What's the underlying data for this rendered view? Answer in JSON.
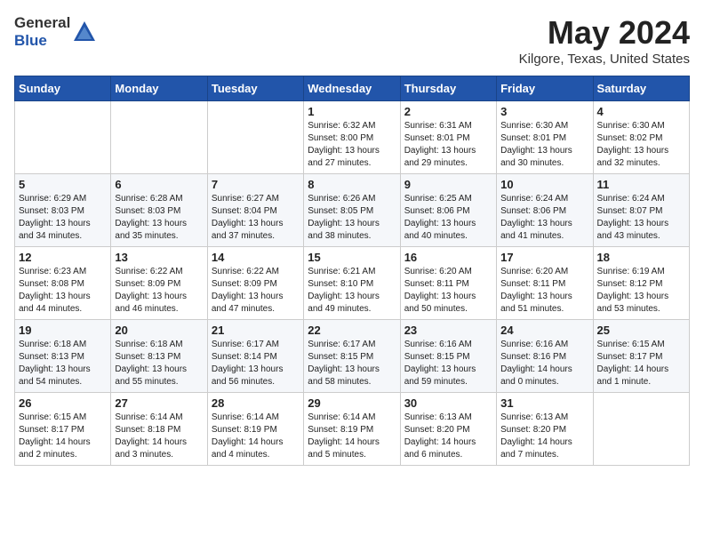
{
  "header": {
    "logo_line1": "General",
    "logo_line2": "Blue",
    "month": "May 2024",
    "location": "Kilgore, Texas, United States"
  },
  "weekdays": [
    "Sunday",
    "Monday",
    "Tuesday",
    "Wednesday",
    "Thursday",
    "Friday",
    "Saturday"
  ],
  "weeks": [
    [
      {
        "day": "",
        "content": ""
      },
      {
        "day": "",
        "content": ""
      },
      {
        "day": "",
        "content": ""
      },
      {
        "day": "1",
        "content": "Sunrise: 6:32 AM\nSunset: 8:00 PM\nDaylight: 13 hours\nand 27 minutes."
      },
      {
        "day": "2",
        "content": "Sunrise: 6:31 AM\nSunset: 8:01 PM\nDaylight: 13 hours\nand 29 minutes."
      },
      {
        "day": "3",
        "content": "Sunrise: 6:30 AM\nSunset: 8:01 PM\nDaylight: 13 hours\nand 30 minutes."
      },
      {
        "day": "4",
        "content": "Sunrise: 6:30 AM\nSunset: 8:02 PM\nDaylight: 13 hours\nand 32 minutes."
      }
    ],
    [
      {
        "day": "5",
        "content": "Sunrise: 6:29 AM\nSunset: 8:03 PM\nDaylight: 13 hours\nand 34 minutes."
      },
      {
        "day": "6",
        "content": "Sunrise: 6:28 AM\nSunset: 8:03 PM\nDaylight: 13 hours\nand 35 minutes."
      },
      {
        "day": "7",
        "content": "Sunrise: 6:27 AM\nSunset: 8:04 PM\nDaylight: 13 hours\nand 37 minutes."
      },
      {
        "day": "8",
        "content": "Sunrise: 6:26 AM\nSunset: 8:05 PM\nDaylight: 13 hours\nand 38 minutes."
      },
      {
        "day": "9",
        "content": "Sunrise: 6:25 AM\nSunset: 8:06 PM\nDaylight: 13 hours\nand 40 minutes."
      },
      {
        "day": "10",
        "content": "Sunrise: 6:24 AM\nSunset: 8:06 PM\nDaylight: 13 hours\nand 41 minutes."
      },
      {
        "day": "11",
        "content": "Sunrise: 6:24 AM\nSunset: 8:07 PM\nDaylight: 13 hours\nand 43 minutes."
      }
    ],
    [
      {
        "day": "12",
        "content": "Sunrise: 6:23 AM\nSunset: 8:08 PM\nDaylight: 13 hours\nand 44 minutes."
      },
      {
        "day": "13",
        "content": "Sunrise: 6:22 AM\nSunset: 8:09 PM\nDaylight: 13 hours\nand 46 minutes."
      },
      {
        "day": "14",
        "content": "Sunrise: 6:22 AM\nSunset: 8:09 PM\nDaylight: 13 hours\nand 47 minutes."
      },
      {
        "day": "15",
        "content": "Sunrise: 6:21 AM\nSunset: 8:10 PM\nDaylight: 13 hours\nand 49 minutes."
      },
      {
        "day": "16",
        "content": "Sunrise: 6:20 AM\nSunset: 8:11 PM\nDaylight: 13 hours\nand 50 minutes."
      },
      {
        "day": "17",
        "content": "Sunrise: 6:20 AM\nSunset: 8:11 PM\nDaylight: 13 hours\nand 51 minutes."
      },
      {
        "day": "18",
        "content": "Sunrise: 6:19 AM\nSunset: 8:12 PM\nDaylight: 13 hours\nand 53 minutes."
      }
    ],
    [
      {
        "day": "19",
        "content": "Sunrise: 6:18 AM\nSunset: 8:13 PM\nDaylight: 13 hours\nand 54 minutes."
      },
      {
        "day": "20",
        "content": "Sunrise: 6:18 AM\nSunset: 8:13 PM\nDaylight: 13 hours\nand 55 minutes."
      },
      {
        "day": "21",
        "content": "Sunrise: 6:17 AM\nSunset: 8:14 PM\nDaylight: 13 hours\nand 56 minutes."
      },
      {
        "day": "22",
        "content": "Sunrise: 6:17 AM\nSunset: 8:15 PM\nDaylight: 13 hours\nand 58 minutes."
      },
      {
        "day": "23",
        "content": "Sunrise: 6:16 AM\nSunset: 8:15 PM\nDaylight: 13 hours\nand 59 minutes."
      },
      {
        "day": "24",
        "content": "Sunrise: 6:16 AM\nSunset: 8:16 PM\nDaylight: 14 hours\nand 0 minutes."
      },
      {
        "day": "25",
        "content": "Sunrise: 6:15 AM\nSunset: 8:17 PM\nDaylight: 14 hours\nand 1 minute."
      }
    ],
    [
      {
        "day": "26",
        "content": "Sunrise: 6:15 AM\nSunset: 8:17 PM\nDaylight: 14 hours\nand 2 minutes."
      },
      {
        "day": "27",
        "content": "Sunrise: 6:14 AM\nSunset: 8:18 PM\nDaylight: 14 hours\nand 3 minutes."
      },
      {
        "day": "28",
        "content": "Sunrise: 6:14 AM\nSunset: 8:19 PM\nDaylight: 14 hours\nand 4 minutes."
      },
      {
        "day": "29",
        "content": "Sunrise: 6:14 AM\nSunset: 8:19 PM\nDaylight: 14 hours\nand 5 minutes."
      },
      {
        "day": "30",
        "content": "Sunrise: 6:13 AM\nSunset: 8:20 PM\nDaylight: 14 hours\nand 6 minutes."
      },
      {
        "day": "31",
        "content": "Sunrise: 6:13 AM\nSunset: 8:20 PM\nDaylight: 14 hours\nand 7 minutes."
      },
      {
        "day": "",
        "content": ""
      }
    ]
  ]
}
